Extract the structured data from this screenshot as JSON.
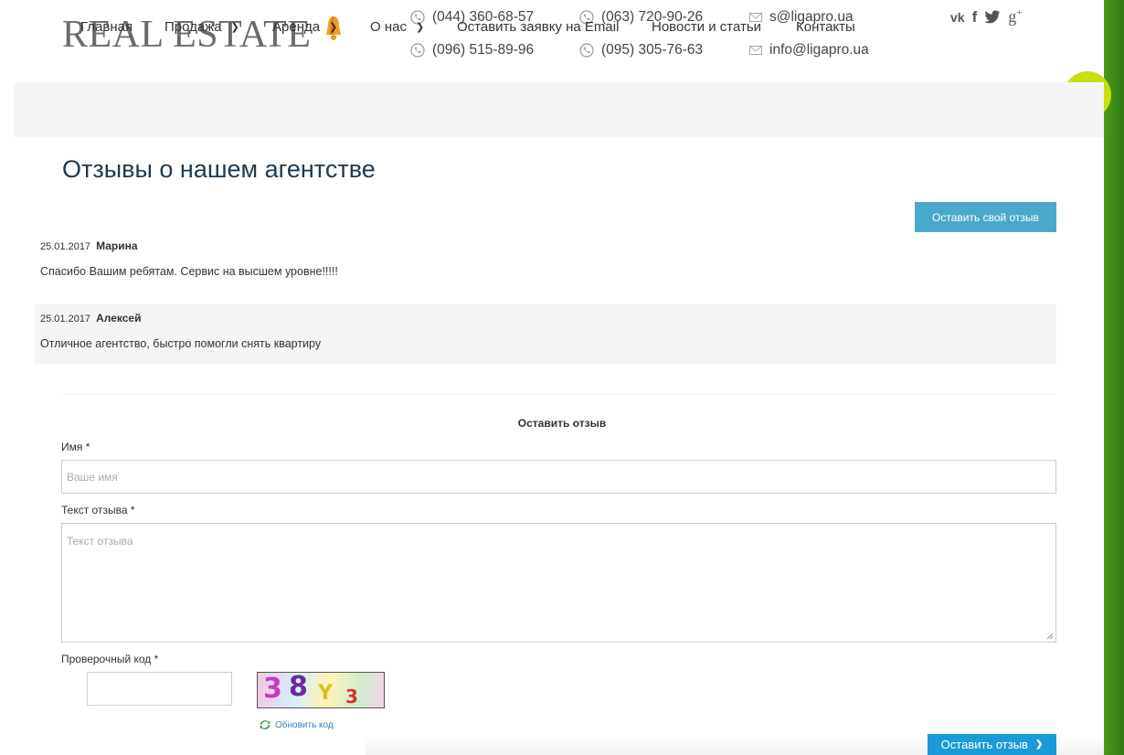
{
  "header": {
    "logo": "REAL ESTATE",
    "phones": [
      "(044) 360-68-57",
      "(063) 720-90-26",
      "(096) 515-89-96",
      "(095) 305-76-63"
    ],
    "emails": [
      "s@ligapro.ua",
      "info@ligapro.ua"
    ],
    "social": [
      "vk-icon",
      "facebook-icon",
      "twitter-icon",
      "google-plus-icon"
    ]
  },
  "nav": {
    "items": [
      {
        "label": "Главная"
      },
      {
        "label": "Продажа"
      },
      {
        "label": "Аренда"
      },
      {
        "label": "О нас"
      },
      {
        "label": "Оставить заявку на Email"
      },
      {
        "label": "Новости и статьи"
      },
      {
        "label": "Контакты"
      }
    ]
  },
  "page": {
    "title": "Отзывы о нашем агентстве",
    "add_review_button": "Оставить свой отзыв"
  },
  "reviews": [
    {
      "date": "25.01.2017",
      "author": "Марина",
      "text": "Спасибо Вашим ребятам. Сервис на высшем уровне!!!!!"
    },
    {
      "date": "25.01.2017",
      "author": "Алексей",
      "text": "Отличное агентство, быстро помогли снять квартиру"
    }
  ],
  "form": {
    "title": "Оставить отзыв",
    "name_label": "Имя *",
    "name_placeholder": "Ваше имя",
    "text_label": "Текст отзыва *",
    "text_placeholder": "Текст отзыва",
    "captcha_label": "Проверочный код *",
    "captcha_chars": [
      "3",
      "8",
      "Y",
      "3"
    ],
    "refresh_label": "Обновить код",
    "submit_label": "Оставить отзыв"
  },
  "colors": {
    "accent_blue": "#4aa8cc",
    "call_bubble": "#c8de12",
    "title_color": "#1f3a4d"
  }
}
